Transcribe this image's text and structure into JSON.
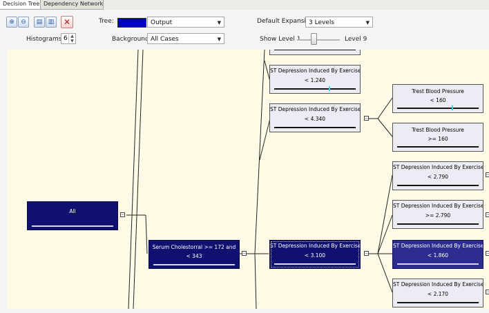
{
  "tabs": [
    {
      "label": "Decision Tree",
      "active": true
    },
    {
      "label": "Dependency Network",
      "active": false
    }
  ],
  "toolbar": {
    "tree_label": "Tree:",
    "tree_value": "Output",
    "tree_color": "#0000c8",
    "background_label": "Background:",
    "background_value": "All Cases",
    "histograms_label": "Histograms:",
    "histograms_value": "6",
    "default_expansion_label": "Default Expansion:",
    "default_expansion_value": "3 Levels",
    "show_level_label": "Show Level 1",
    "level_max_label": "Level 9"
  },
  "nodes": {
    "all": {
      "title": "All",
      "sub": ""
    },
    "serum": {
      "title": "Serum Cholestorral >= 172 and",
      "sub": "< 343"
    },
    "st_124": {
      "title": "ST Depression Induced By Exercise...",
      "sub": "< 1.240"
    },
    "st_434": {
      "title": "ST Depression Induced By Exercise...",
      "sub": "< 4.340"
    },
    "st_310": {
      "title": "ST Depression Induced By Exercise...",
      "sub": "< 3.100"
    },
    "trest_lt": {
      "title": "Trest Blood Pressure",
      "sub": "< 160"
    },
    "trest_ge": {
      "title": "Trest Blood Pressure",
      "sub": ">= 160"
    },
    "st_279_lt": {
      "title": "ST Depression Induced By Exercise...",
      "sub": "< 2.790"
    },
    "st_279_ge": {
      "title": "ST Depression Induced By Exercise...",
      "sub": ">= 2.790"
    },
    "st_186": {
      "title": "ST Depression Induced By Exercise...",
      "sub": "< 1.860"
    },
    "st_217": {
      "title": "ST Depression Induced By Exercise...",
      "sub": "< 2.170"
    }
  },
  "colors": {
    "canvas": "#fefae6",
    "node_dark": "#101071",
    "node_mid": "#2d2d90",
    "node_light": "#ececf4",
    "histogram_diamond": "#33d6f0"
  },
  "icons": [
    "zoom-in-icon",
    "zoom-out-icon",
    "expand-icon",
    "collapse-icon",
    "fit-to-window-icon"
  ]
}
